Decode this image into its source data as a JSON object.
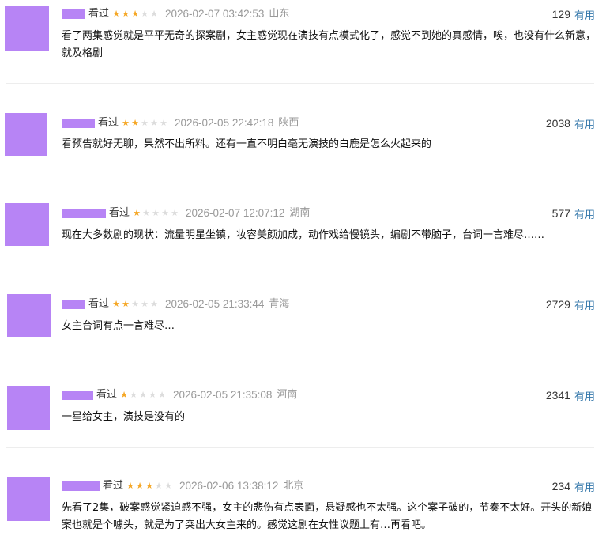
{
  "comments": [
    {
      "status": "看过",
      "rating": 3,
      "time": "2026-02-07 03:42:53",
      "location": "山东",
      "votes": "129",
      "useful_label": "有用",
      "content": "看了两集感觉就是平平无奇的探案剧，女主感觉现在演技有点模式化了，感觉不到她的真感情，唉，也没有什么新意，就及格剧"
    },
    {
      "status": "看过",
      "rating": 2,
      "time": "2026-02-05 22:42:18",
      "location": "陕西",
      "votes": "2038",
      "useful_label": "有用",
      "content": "看预告就好无聊，果然不出所料。还有一直不明白毫无演技的白鹿是怎么火起来的"
    },
    {
      "status": "看过",
      "rating": 1,
      "time": "2026-02-07 12:07:12",
      "location": "湖南",
      "votes": "577",
      "useful_label": "有用",
      "content": "现在大多数剧的现状：流量明星坐镇，妆容美颜加成，动作戏给慢镜头，编剧不带脑子，台词一言难尽……"
    },
    {
      "status": "看过",
      "rating": 2,
      "time": "2026-02-05 21:33:44",
      "location": "青海",
      "votes": "2729",
      "useful_label": "有用",
      "content": "女主台词有点一言难尽…"
    },
    {
      "status": "看过",
      "rating": 1,
      "time": "2026-02-05 21:35:08",
      "location": "河南",
      "votes": "2341",
      "useful_label": "有用",
      "content": "一星给女主，演技是没有的"
    },
    {
      "status": "看过",
      "rating": 3,
      "time": "2026-02-06 13:38:12",
      "location": "北京",
      "votes": "234",
      "useful_label": "有用",
      "content": "先看了2集，破案感觉紧迫感不强，女主的悲伤有点表面，悬疑感也不太强。这个案子破的，节奏不太好。开头的新娘案也就是个噱头，就是为了突出大女主来的。感觉这剧在女性议题上有…再看吧。"
    }
  ],
  "colors": {
    "avatar": "#b784f5",
    "star_on": "#f5a623",
    "star_off": "#dcdcdc",
    "link": "#3377aa",
    "meta": "#999999"
  }
}
